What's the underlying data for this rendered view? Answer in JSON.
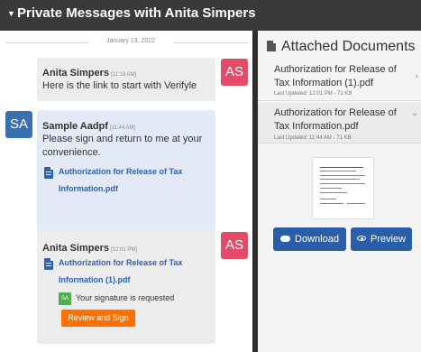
{
  "header": {
    "title": "Private Messages with Anita Simpers"
  },
  "chat": {
    "date_divider": "January 13, 2022",
    "messages": [
      {
        "sender": "Anita Simpers",
        "time": "[11:18 AM]",
        "text": "Here is the link to start with Verifyle",
        "avatar": "AS"
      },
      {
        "sender": "Sample Aadpf",
        "time": "[11:44 AM]",
        "text": "Please sign and return to me at your convenience.",
        "attachment": "Authorization for Release of Tax Information.pdf",
        "avatar": "SA"
      },
      {
        "sender": "Anita Simpers",
        "time": "[12:01 PM]",
        "attachment": "Authorization for Release of Tax Information (1).pdf",
        "avatar": "AS",
        "signature": {
          "badge": "SA",
          "text": "Your signature is requested",
          "button": "Review and Sign"
        }
      }
    ]
  },
  "attachments": {
    "title": "Attached Documents",
    "documents": [
      {
        "name": "Authorization for Release of Tax Information (1).pdf",
        "meta": "Last Updated: 12:01 PM - 71 KB"
      },
      {
        "name": "Authorization for Release of Tax Information.pdf",
        "meta": "Last Updated: 11:44 AM - 71 KB"
      }
    ],
    "download_label": "Download",
    "preview_label": "Preview"
  },
  "colors": {
    "avatar_anita": "#e34b6a",
    "avatar_sample": "#3a6fb0",
    "action_blue": "#2a5fa7",
    "review_orange": "#ff7000"
  }
}
